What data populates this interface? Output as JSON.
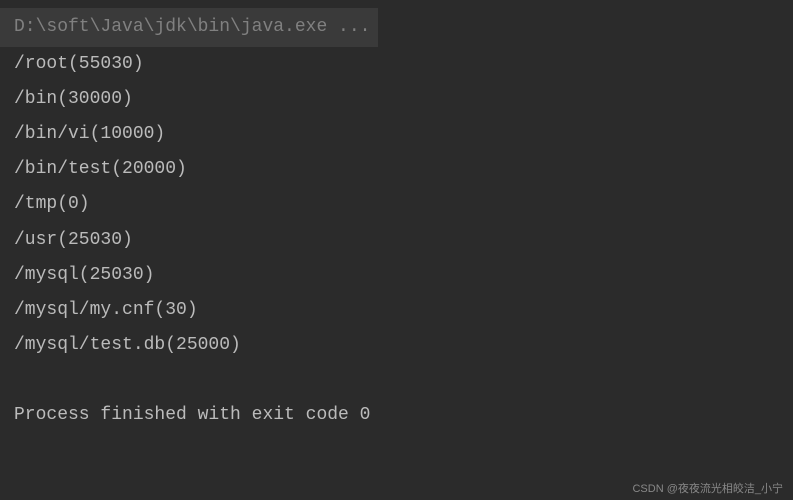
{
  "console": {
    "header": "D:\\soft\\Java\\jdk\\bin\\java.exe ...",
    "lines": {
      "line0": "/root(55030)",
      "line1": "/bin(30000)",
      "line2": "/bin/vi(10000)",
      "line3": "/bin/test(20000)",
      "line4": "/tmp(0)",
      "line5": "/usr(25030)",
      "line6": "/mysql(25030)",
      "line7": "/mysql/my.cnf(30)",
      "line8": "/mysql/test.db(25000)"
    },
    "footer": "Process finished with exit code 0"
  },
  "watermark": "CSDN @夜夜流光相皎洁_小宁"
}
